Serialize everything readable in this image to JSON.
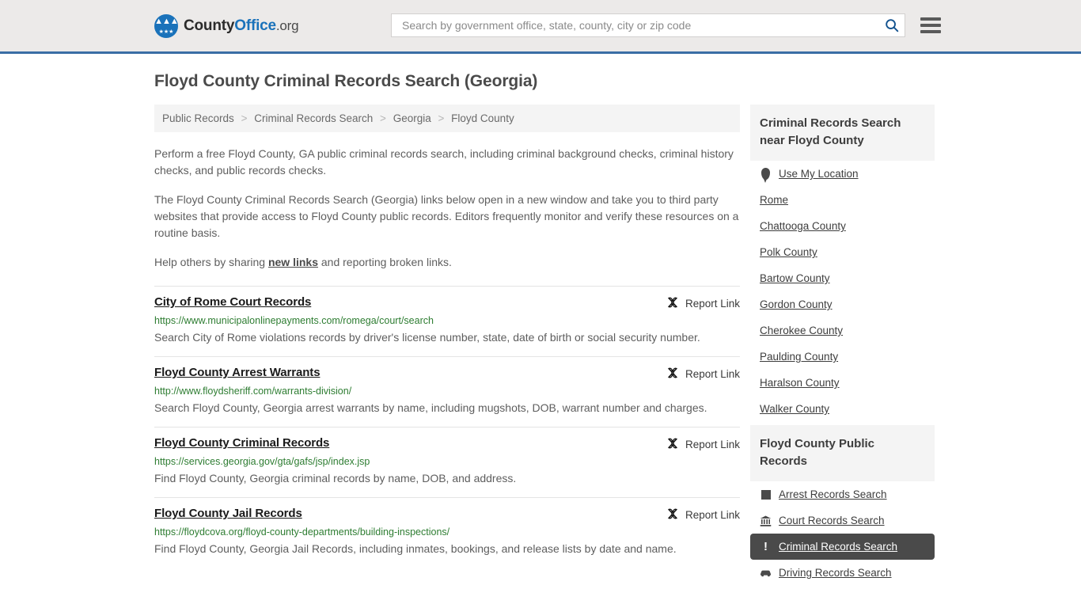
{
  "header": {
    "logo": {
      "part1": "County",
      "part2": "Office",
      "part3": ".org",
      "icon": "eagle-shield-logo"
    },
    "search": {
      "placeholder": "Search by government office, state, county, city or zip code",
      "value": "",
      "search_icon": "search-icon"
    },
    "menu_icon": "hamburger-menu-icon",
    "accent_color": "#3a6ea5"
  },
  "page": {
    "title": "Floyd County Criminal Records Search (Georgia)"
  },
  "breadcrumb": {
    "separator": ">",
    "items": [
      {
        "label": "Public Records"
      },
      {
        "label": "Criminal Records Search"
      },
      {
        "label": "Georgia"
      },
      {
        "label": "Floyd County"
      }
    ]
  },
  "intro": {
    "p1": "Perform a free Floyd County, GA public criminal records search, including criminal background checks, criminal history checks, and public records checks.",
    "p2": "The Floyd County Criminal Records Search (Georgia) links below open in a new window and take you to third party websites that provide access to Floyd County public records. Editors frequently monitor and verify these resources on a routine basis.",
    "p3_before": "Help others by sharing ",
    "p3_link": "new links",
    "p3_after": " and reporting broken links."
  },
  "results": {
    "report_label": "Report Link",
    "report_icon": "broken-link-icon",
    "items": [
      {
        "title": "City of Rome Court Records",
        "url": "https://www.municipalonlinepayments.com/romega/court/search",
        "description": "Search City of Rome violations records by driver's license number, state, date of birth or social security number."
      },
      {
        "title": "Floyd County Arrest Warrants",
        "url": "http://www.floydsheriff.com/warrants-division/",
        "description": "Search Floyd County, Georgia arrest warrants by name, including mugshots, DOB, warrant number and charges."
      },
      {
        "title": "Floyd County Criminal Records",
        "url": "https://services.georgia.gov/gta/gafs/jsp/index.jsp",
        "description": "Find Floyd County, Georgia criminal records by name, DOB, and address."
      },
      {
        "title": "Floyd County Jail Records",
        "url": "https://floydcova.org/floyd-county-departments/building-inspections/",
        "description": "Find Floyd County, Georgia Jail Records, including inmates, bookings, and release lists by date and name."
      }
    ]
  },
  "sidebar": {
    "nearby": {
      "heading": "Criminal Records Search near Floyd County",
      "items": [
        {
          "label": "Use My Location",
          "icon": "map-pin-icon",
          "active": false
        },
        {
          "label": "Rome",
          "icon": "",
          "active": false
        },
        {
          "label": "Chattooga County",
          "icon": "",
          "active": false
        },
        {
          "label": "Polk County",
          "icon": "",
          "active": false
        },
        {
          "label": "Bartow County",
          "icon": "",
          "active": false
        },
        {
          "label": "Gordon County",
          "icon": "",
          "active": false
        },
        {
          "label": "Cherokee County",
          "icon": "",
          "active": false
        },
        {
          "label": "Paulding County",
          "icon": "",
          "active": false
        },
        {
          "label": "Haralson County",
          "icon": "",
          "active": false
        },
        {
          "label": "Walker County",
          "icon": "",
          "active": false
        }
      ]
    },
    "public_records": {
      "heading": "Floyd County Public Records",
      "items": [
        {
          "label": "Arrest Records Search",
          "icon": "square-icon",
          "active": false
        },
        {
          "label": "Court Records Search",
          "icon": "courthouse-icon",
          "active": false
        },
        {
          "label": "Criminal Records Search",
          "icon": "exclamation-icon",
          "active": true
        },
        {
          "label": "Driving Records Search",
          "icon": "car-icon",
          "active": false
        }
      ]
    },
    "active_background": "#4a4a4a"
  }
}
